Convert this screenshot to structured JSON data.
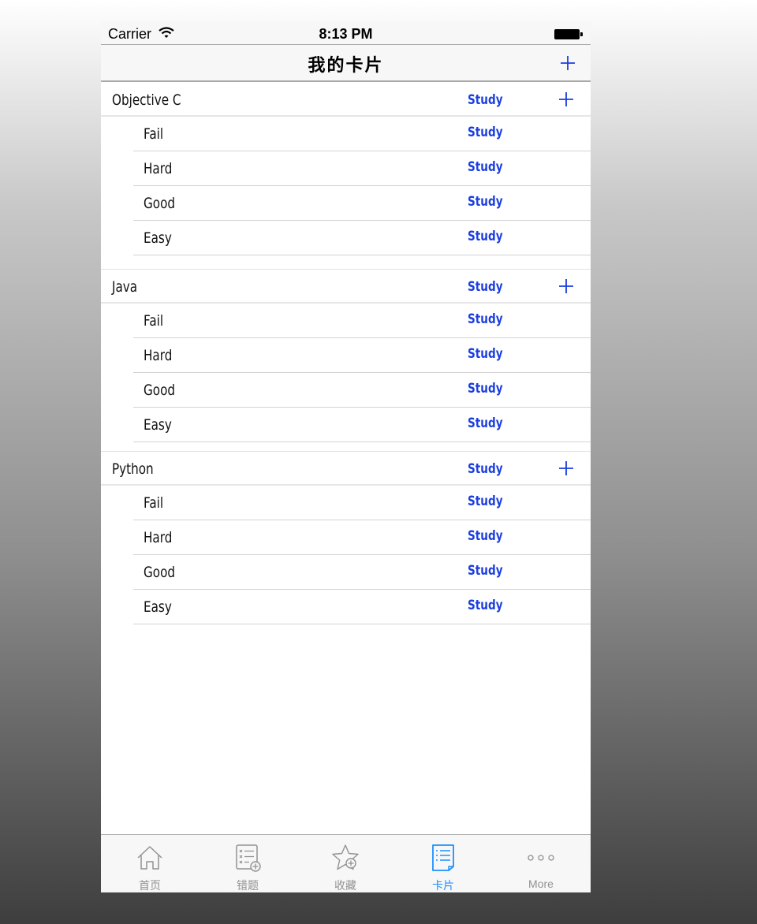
{
  "status_bar": {
    "carrier": "Carrier",
    "time": "8:13 PM"
  },
  "nav": {
    "title": "我的卡片",
    "add_icon": "plus-icon"
  },
  "decks": [
    {
      "title": "Objective C",
      "study_label": "Study",
      "rows": [
        {
          "label": "Fail",
          "study_label": "Study"
        },
        {
          "label": "Hard",
          "study_label": "Study"
        },
        {
          "label": "Good",
          "study_label": "Study"
        },
        {
          "label": "Easy",
          "study_label": "Study"
        }
      ]
    },
    {
      "title": "Java",
      "study_label": "Study",
      "rows": [
        {
          "label": "Fail",
          "study_label": "Study"
        },
        {
          "label": "Hard",
          "study_label": "Study"
        },
        {
          "label": "Good",
          "study_label": "Study"
        },
        {
          "label": "Easy",
          "study_label": "Study"
        }
      ]
    },
    {
      "title": "Python",
      "study_label": "Study",
      "rows": [
        {
          "label": "Fail",
          "study_label": "Study"
        },
        {
          "label": "Hard",
          "study_label": "Study"
        },
        {
          "label": "Good",
          "study_label": "Study"
        },
        {
          "label": "Easy",
          "study_label": "Study"
        }
      ]
    }
  ],
  "tabs": [
    {
      "label": "首页",
      "icon": "home-icon",
      "active": false
    },
    {
      "label": "错题",
      "icon": "wrong-questions-icon",
      "active": false
    },
    {
      "label": "收藏",
      "icon": "star-add-icon",
      "active": false
    },
    {
      "label": "卡片",
      "icon": "cards-list-icon",
      "active": true
    },
    {
      "label": "More",
      "icon": "more-dots-icon",
      "active": false
    }
  ],
  "colors": {
    "accent": "#1a3ee0",
    "tab_active": "#1e90ff",
    "tab_inactive": "#929292"
  }
}
